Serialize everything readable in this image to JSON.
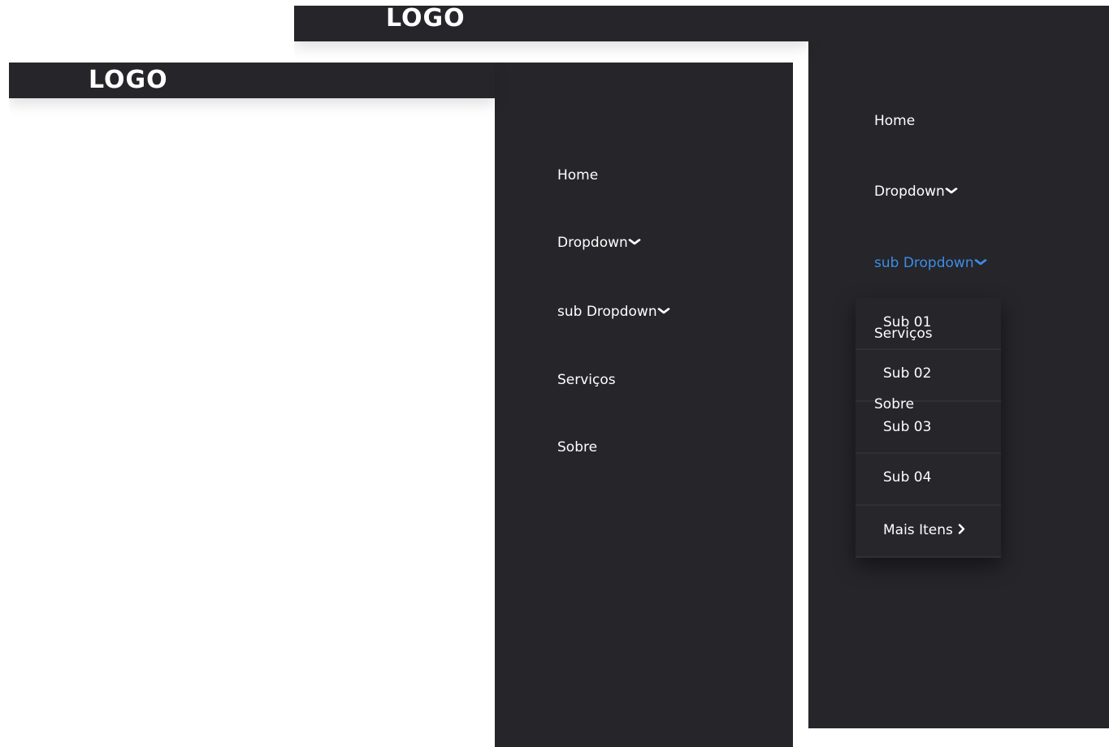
{
  "front": {
    "logo": "LOGO",
    "nav": [
      {
        "label": "Home"
      },
      {
        "label": "Dropdown",
        "chevron": "❯"
      },
      {
        "label": "sub Dropdown",
        "chevron": "❯"
      },
      {
        "label": "Serviços"
      },
      {
        "label": "Sobre"
      }
    ]
  },
  "back": {
    "logo": "LOGO",
    "nav": [
      {
        "label": "Home"
      },
      {
        "label": "Dropdown"
      },
      {
        "label": "sub Dropdown"
      }
    ],
    "submenu": [
      {
        "label": "Sub 01"
      },
      {
        "label": "Sub 02"
      },
      {
        "label": "Sub 03"
      },
      {
        "label": "Sub 04"
      },
      {
        "label": "Mais Itens"
      }
    ],
    "overflow_labels": [
      {
        "label": "Serviços"
      },
      {
        "label": "Sobre"
      }
    ]
  },
  "colors": {
    "panel_bg": "#25252a",
    "text": "#ffffff",
    "active": "#3d8de6"
  },
  "icons": {
    "chevron": "chevron-down-icon",
    "arrow": "chevron-right-icon"
  }
}
